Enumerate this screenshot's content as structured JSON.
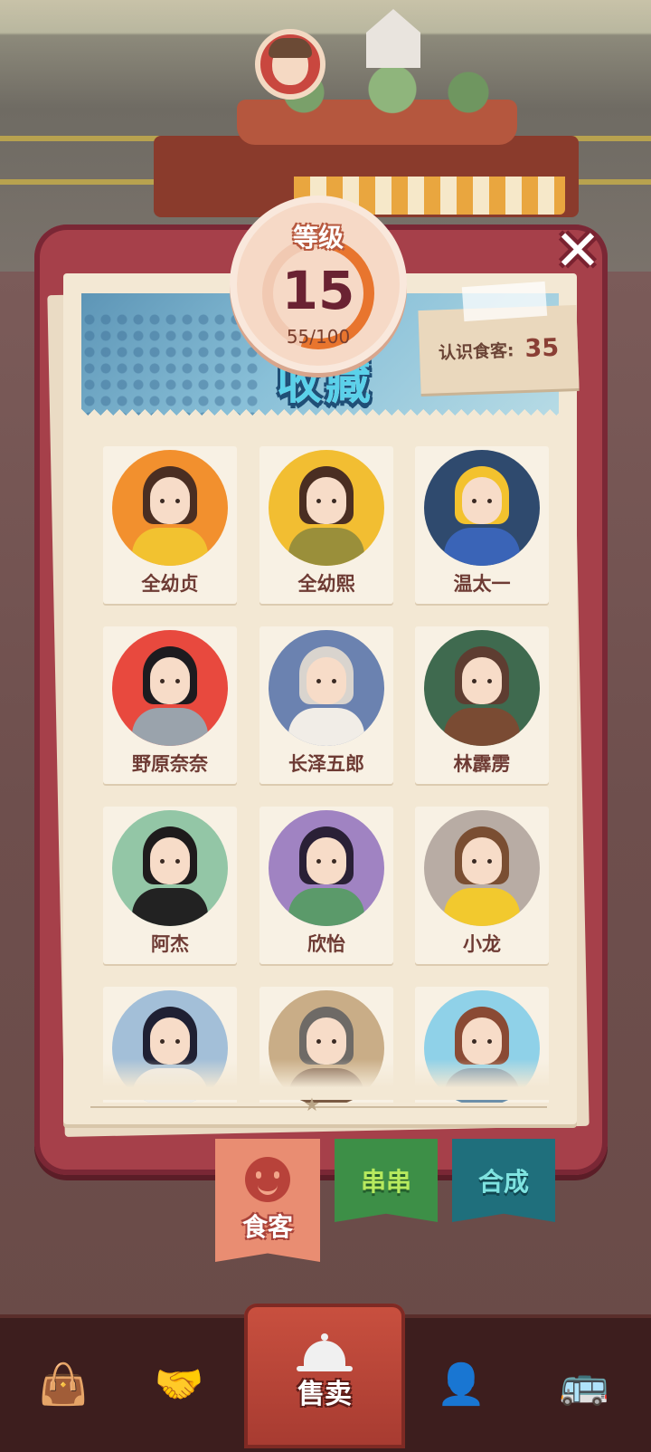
{
  "level_badge": {
    "label": "等级",
    "level": "15",
    "exp_text": "55/100",
    "progress": 0.55
  },
  "panel": {
    "title": "收藏",
    "known_customers_label": "认识食客:",
    "known_customers_count": "35"
  },
  "close_button": {
    "symbol": "✕"
  },
  "customers": [
    {
      "name": "全幼贞",
      "bg": "#f2902e",
      "hair": "#4a2e22",
      "body": "#f2c230"
    },
    {
      "name": "全幼熙",
      "bg": "#f2be32",
      "hair": "#4a2e22",
      "body": "#9a8f3a"
    },
    {
      "name": "温太一",
      "bg": "#2f4a6e",
      "hair": "#f3c22e",
      "body": "#3a64b7"
    },
    {
      "name": "野原奈奈",
      "bg": "#e8493e",
      "hair": "#1d1b1f",
      "body": "#9aa3ac"
    },
    {
      "name": "长泽五郎",
      "bg": "#6b82b0",
      "hair": "#d9d4ce",
      "body": "#f1ede7"
    },
    {
      "name": "林霹雳",
      "bg": "#3f6a4f",
      "hair": "#5e3d31",
      "body": "#7a4b33"
    },
    {
      "name": "阿杰",
      "bg": "#93c6a6",
      "hair": "#1e1b1c",
      "body": "#222"
    },
    {
      "name": "欣怡",
      "bg": "#a083c2",
      "hair": "#2a2036",
      "body": "#5b9a6a"
    },
    {
      "name": "小龙",
      "bg": "#b8aca4",
      "hair": "#7a4e32",
      "body": "#f2c92e"
    },
    {
      "name": "",
      "bg": "#a3bfd8",
      "hair": "#1f2033",
      "body": "#f1ede7"
    },
    {
      "name": "",
      "bg": "#c9ad87",
      "hair": "#6e6a66",
      "body": "#7a5a43"
    },
    {
      "name": "",
      "bg": "#8fd1e8",
      "hair": "#8a4a34",
      "body": "#6c8fa9"
    }
  ],
  "side_tabs": {
    "customers": "食客",
    "skewers": "串串",
    "craft": "合成"
  },
  "bottom_nav": {
    "sell_label": "售卖"
  },
  "colors": {
    "panel": "#a6404a",
    "paper": "#f3e8d4",
    "title": "#5ad1ea"
  }
}
